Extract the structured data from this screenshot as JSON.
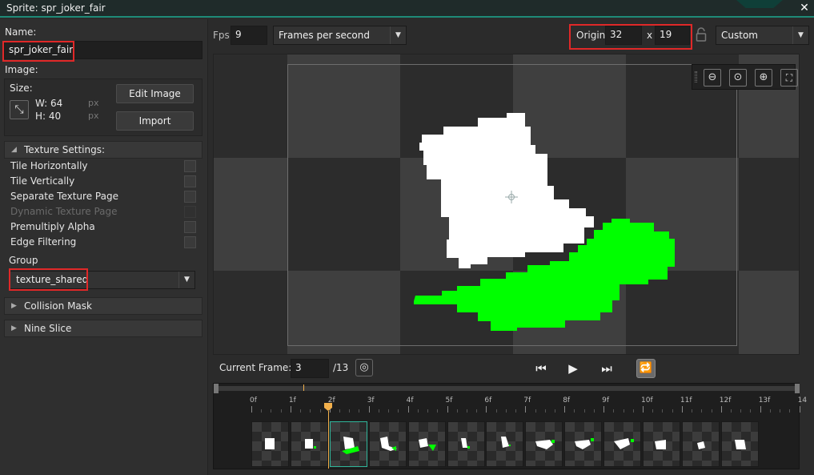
{
  "window": {
    "title": "Sprite: spr_joker_fair"
  },
  "left": {
    "name_label": "Name:",
    "name_value": "spr_joker_fair",
    "image_label": "Image:",
    "size_label": "Size:",
    "width_label": "W: 64",
    "height_label": "H: 40",
    "unit_px": "px",
    "edit_image": "Edit Image",
    "import": "Import",
    "texture_settings": "Texture Settings:",
    "options": [
      {
        "label": "Tile Horizontally",
        "enabled": true
      },
      {
        "label": "Tile Vertically",
        "enabled": true
      },
      {
        "label": "Separate Texture Page",
        "enabled": true
      },
      {
        "label": "Dynamic Texture Page",
        "enabled": false
      },
      {
        "label": "Premultiply Alpha",
        "enabled": true
      },
      {
        "label": "Edge Filtering",
        "enabled": true
      }
    ],
    "group_label": "Group",
    "group_value": "texture_shared",
    "collision_mask": "Collision Mask",
    "nine_slice": "Nine Slice"
  },
  "top": {
    "fps_label": "Fps",
    "fps_value": "9",
    "fps_mode": "Frames per second",
    "origin_label": "Origin",
    "origin_x": "32",
    "origin_sep": "x",
    "origin_y": "19",
    "origin_preset": "Custom"
  },
  "playback": {
    "current_frame_label": "Current Frame:",
    "current_frame": "3",
    "total_frames": "/13"
  },
  "timeline": {
    "ticks": [
      "0f",
      "1f",
      "2f",
      "3f",
      "4f",
      "5f",
      "6f",
      "7f",
      "8f",
      "9f",
      "10f",
      "11f",
      "12f",
      "13f",
      "14"
    ],
    "selected_frame": 2,
    "frame_count": 13
  },
  "colors": {
    "accent": "#1e8a78",
    "highlight": "#e02828",
    "sprite_white": "#ffffff",
    "sprite_green": "#00ff00",
    "playhead": "#f2b04c"
  }
}
